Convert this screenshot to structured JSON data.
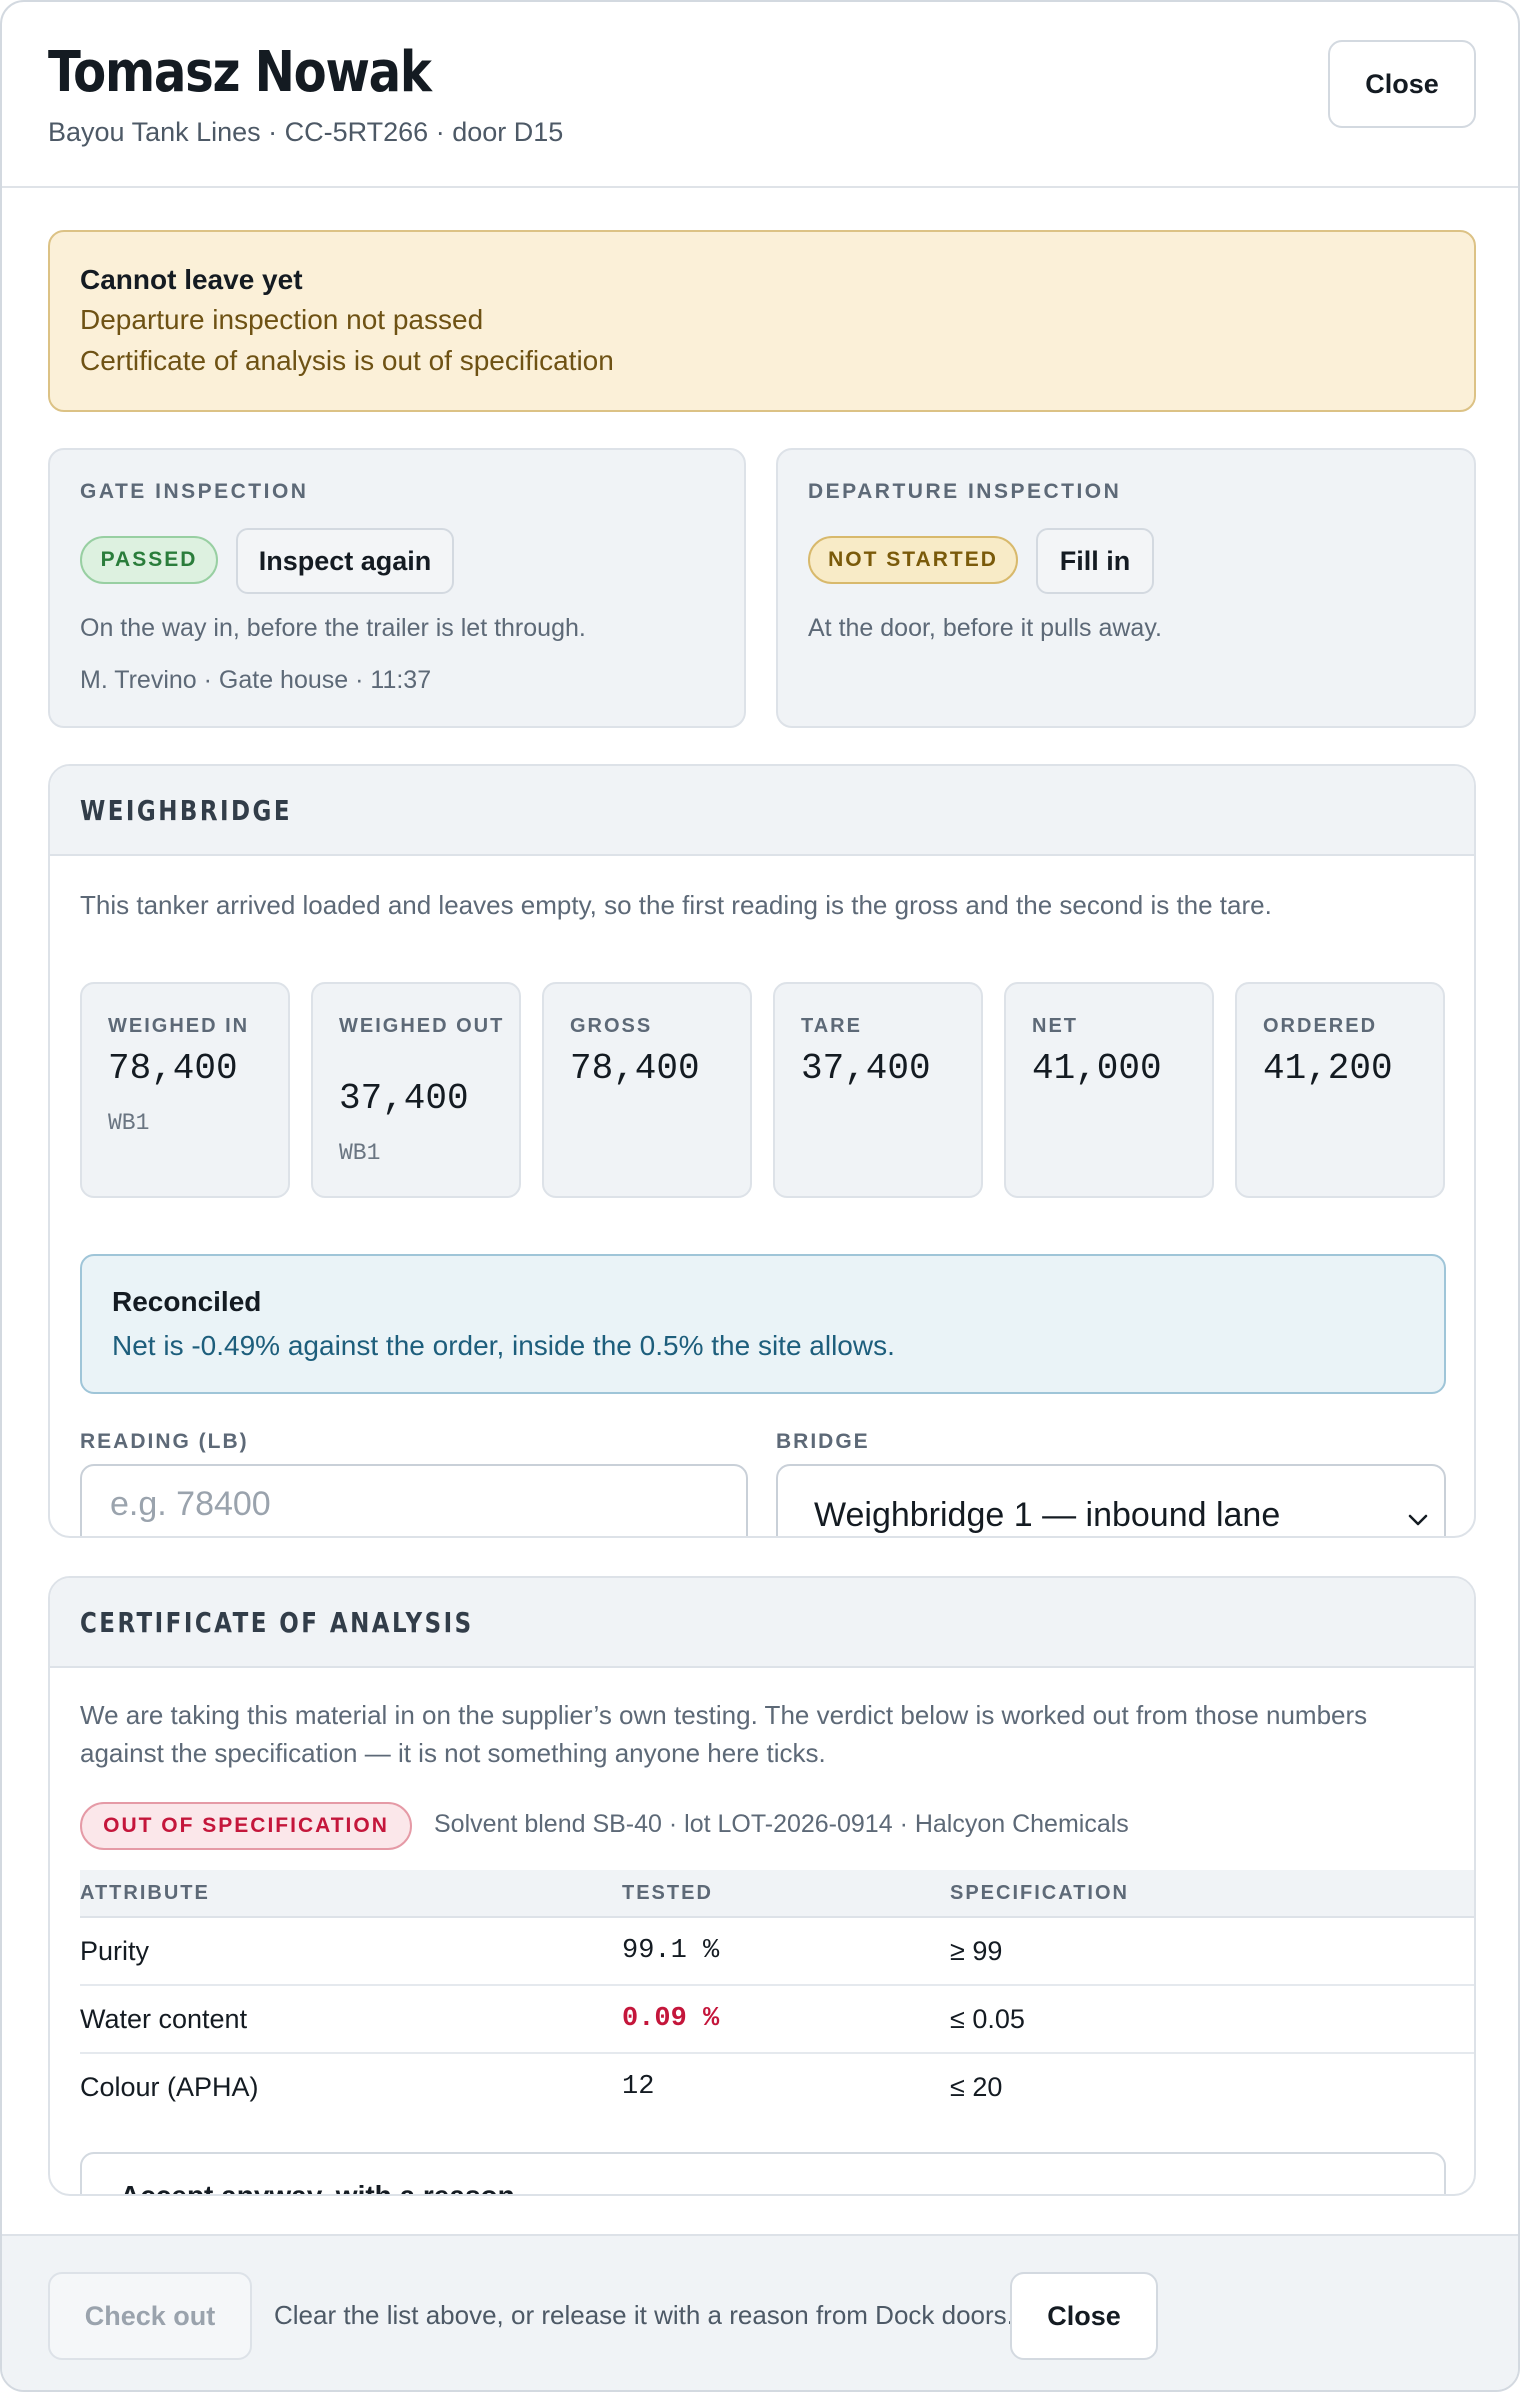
{
  "header": {
    "name": "Tomasz Nowak",
    "subtitle": "Bayou Tank Lines · CC-5RT266 · door D15",
    "close_label": "Close"
  },
  "banner": {
    "title": "Cannot leave yet",
    "lines": [
      "Departure inspection not passed",
      "Certificate of analysis is out of specification"
    ]
  },
  "gate_inspection": {
    "label": "GATE INSPECTION",
    "status": "PASSED",
    "action": "Inspect again",
    "description": "On the way in, before the trailer is let through.",
    "meta": "M. Trevino · Gate house · 11:37"
  },
  "departure_inspection": {
    "label": "DEPARTURE INSPECTION",
    "status": "NOT STARTED",
    "action": "Fill in",
    "description": "At the door, before it pulls away."
  },
  "weighbridge": {
    "title": "WEIGHBRIDGE",
    "intro": "This tanker arrived loaded and leaves empty, so the first reading is the gross and the second is the tare.",
    "tiles": [
      {
        "label": "WEIGHED IN",
        "value": "78,400",
        "bridge": "WB1"
      },
      {
        "label": "WEIGHED OUT",
        "value": "37,400",
        "bridge": "WB1"
      },
      {
        "label": "GROSS",
        "value": "78,400"
      },
      {
        "label": "TARE",
        "value": "37,400"
      },
      {
        "label": "NET",
        "value": "41,000"
      },
      {
        "label": "ORDERED",
        "value": "41,200"
      }
    ],
    "reconciled_title": "Reconciled",
    "reconciled_text": "Net is -0.49% against the order, inside the 0.5% the site allows.",
    "reading_label": "READING (LB)",
    "reading_placeholder": "e.g. 78400",
    "bridge_label": "BRIDGE",
    "bridge_value": "Weighbridge 1 — inbound lane"
  },
  "coa": {
    "title": "CERTIFICATE OF ANALYSIS",
    "intro": "We are taking this material in on the supplier’s own testing. The verdict below is worked out from those numbers against the specification — it is not something anyone here ticks.",
    "verdict": "OUT OF SPECIFICATION",
    "meta": "Solvent blend SB-40 · lot LOT-2026-0914 · Halcyon Chemicals",
    "columns": [
      "ATTRIBUTE",
      "TESTED",
      "SPECIFICATION"
    ],
    "rows": [
      {
        "attribute": "Purity",
        "tested": "99.1 %",
        "spec": "≥ 99"
      },
      {
        "attribute": "Water content",
        "tested": "0.09 %",
        "spec": "≤ 0.05"
      },
      {
        "attribute": "Colour (APHA)",
        "tested": "12",
        "spec": "≤ 20"
      }
    ],
    "accept_label": "Accept anyway, with a reason"
  },
  "footer": {
    "checkout_label": "Check out",
    "hint": "Clear the list above, or release it with a reason from Dock doors.",
    "close_label": "Close"
  },
  "colors": {
    "passed": "#2a7d3b",
    "warning": "#7a5a0a",
    "error": "#c4163b",
    "info": "#1d5e7c"
  }
}
